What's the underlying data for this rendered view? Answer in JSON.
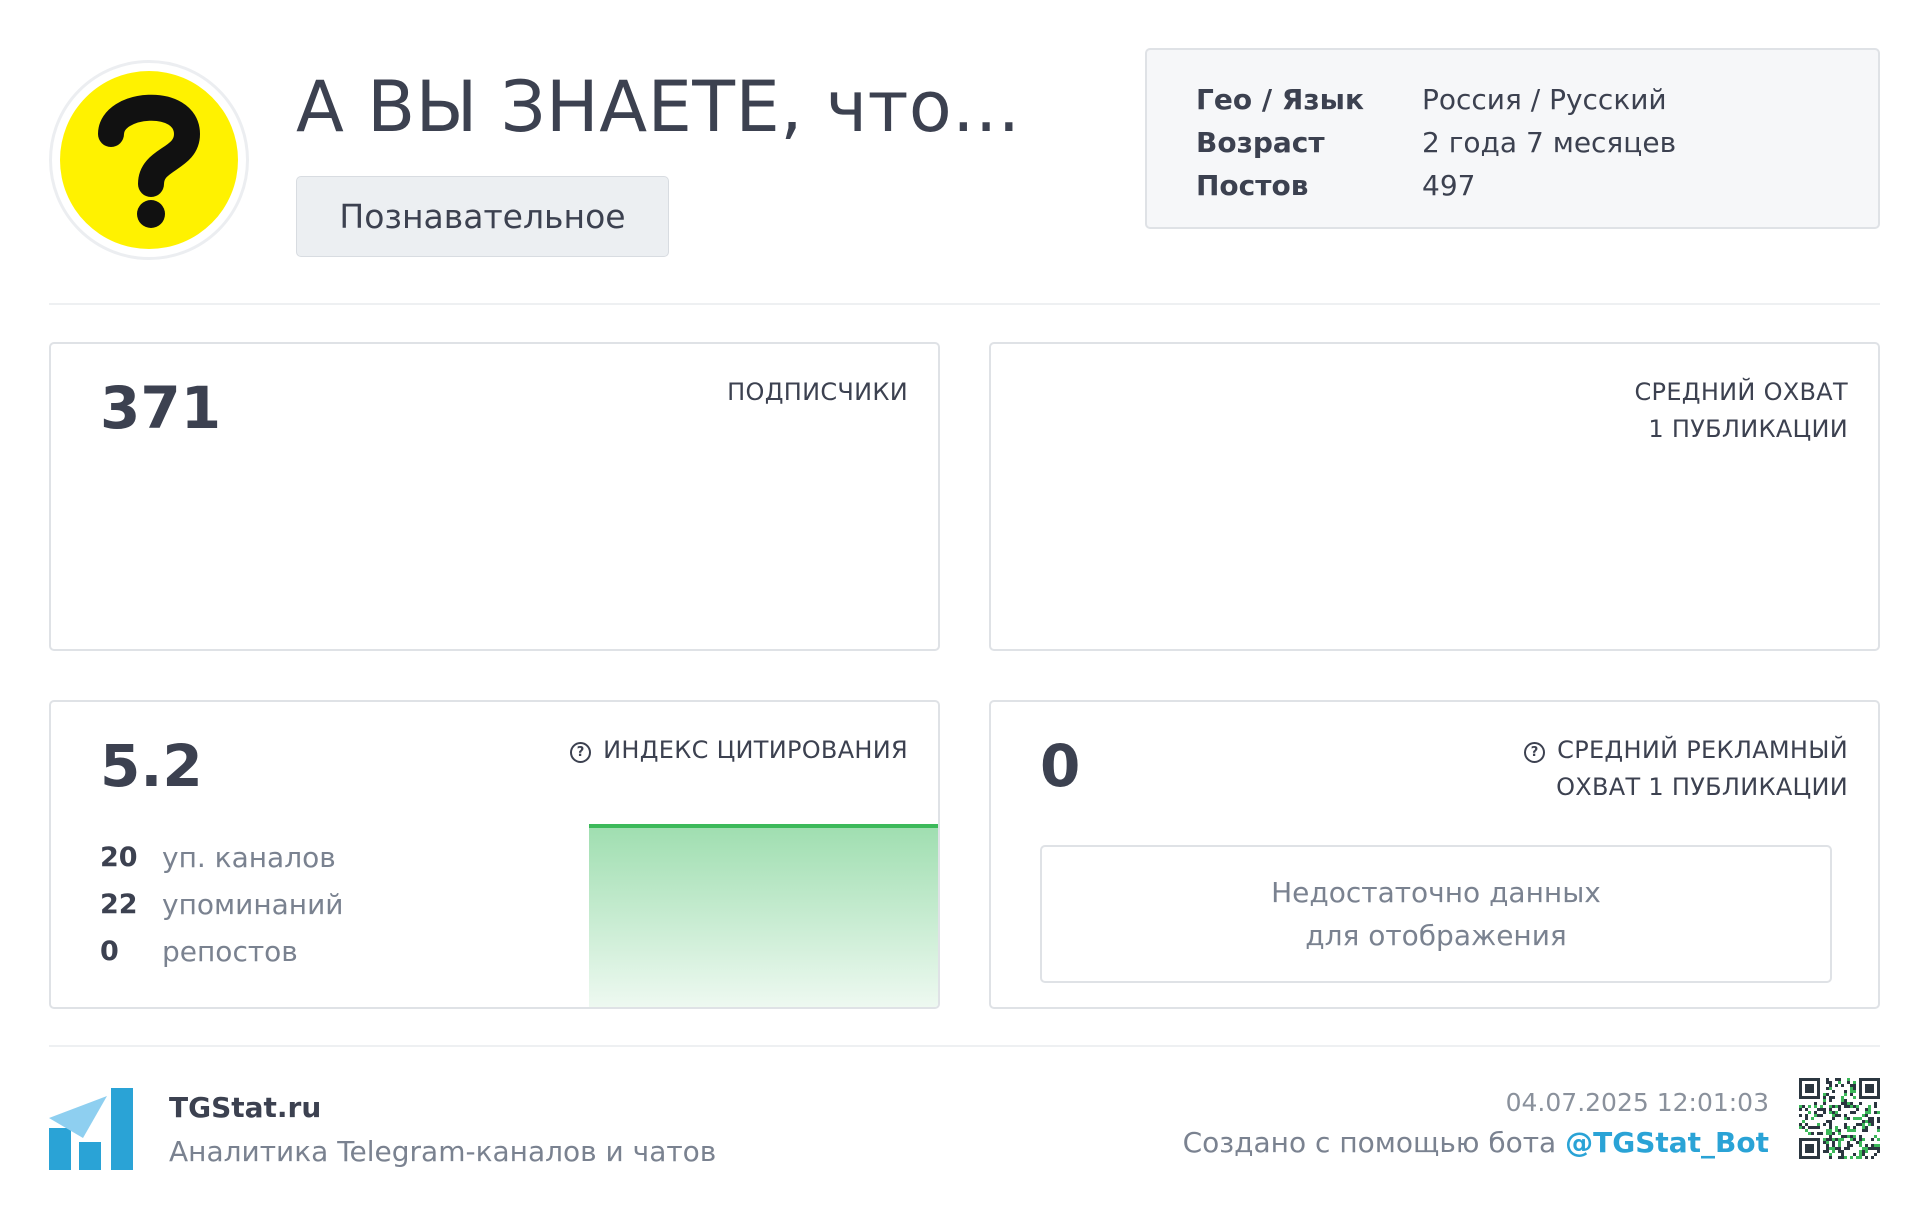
{
  "channel": {
    "title": "А ВЫ ЗНАЕТЕ, что...",
    "category": "Познавательное",
    "avatar_icon": "question-mark-icon",
    "avatar_color": "#fff200"
  },
  "info": [
    {
      "key": "Гео / Язык",
      "value": "Россия / Русский"
    },
    {
      "key": "Возраст",
      "value": "2 года 7 месяцев"
    },
    {
      "key": "Постов",
      "value": "497"
    }
  ],
  "subscribers": {
    "value": "371",
    "label": "ПОДПИСЧИКИ"
  },
  "avg_reach": {
    "label_line1": "СРЕДНИЙ ОХВАТ",
    "label_line2": "1 ПУБЛИКАЦИИ"
  },
  "citation": {
    "value": "5.2",
    "label": "ИНДЕКС ЦИТИРОВАНИЯ",
    "stats": [
      {
        "num": "20",
        "text": "уп. каналов"
      },
      {
        "num": "22",
        "text": "упоминаний"
      },
      {
        "num": "0",
        "text": "репостов"
      }
    ],
    "accent_color": "#3cb95a"
  },
  "ad_reach": {
    "value": "0",
    "label_line1": "СРЕДНИЙ РЕКЛАМНЫЙ",
    "label_line2": "ОХВАТ 1 ПУБЛИКАЦИИ",
    "nodata_line1": "Недостаточно данных",
    "nodata_line2": "для отображения"
  },
  "footer": {
    "site": "TGStat.ru",
    "tagline": "Аналитика Telegram-каналов и чатов",
    "datetime": "04.07.2025 12:01:03",
    "made_with": "Создано с помощью бота ",
    "bot": "@TGStat_Bot",
    "logo_icon": "tgstat-logo-icon",
    "qr_icon": "qr-code-icon",
    "brand_color": "#2aa3d6"
  }
}
